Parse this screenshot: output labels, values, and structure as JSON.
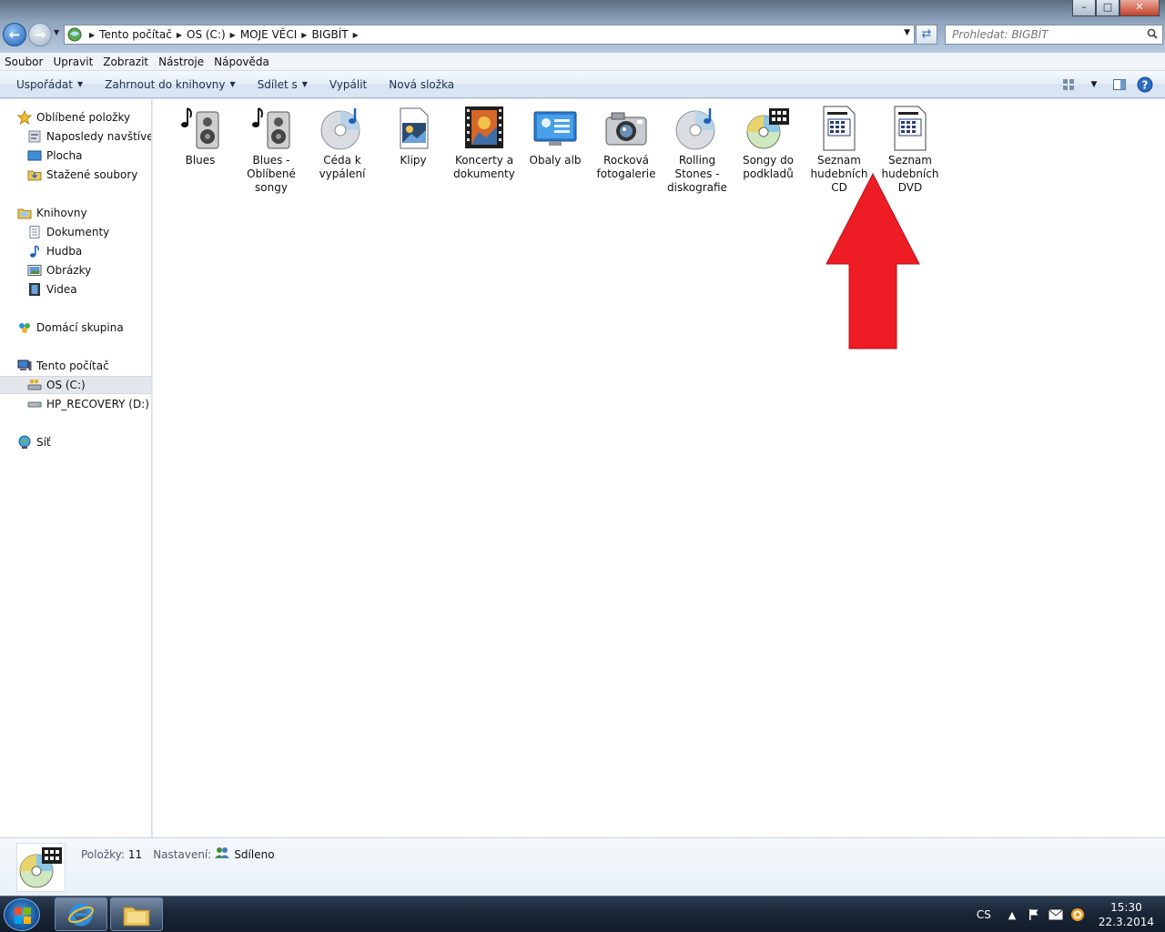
{
  "window": {
    "minimize_glyph": "–",
    "maximize_glyph": "□",
    "close_glyph": "✕"
  },
  "address": {
    "crumbs": [
      "Tento počítač",
      "OS (C:)",
      "MOJE VĚCI",
      "BIGBÍT"
    ],
    "search_placeholder": "Prohledat: BIGBÍT"
  },
  "menu": {
    "items": [
      "Soubor",
      "Upravit",
      "Zobrazit",
      "Nástroje",
      "Nápověda"
    ]
  },
  "commands": {
    "organize": "Uspořádat",
    "include_library": "Zahrnout do knihovny",
    "share_with": "Sdílet s",
    "burn": "Vypálit",
    "new_folder": "Nová složka"
  },
  "nav": {
    "favorites": "Oblíbené položky",
    "recent": "Naposledy navštívené",
    "desktop": "Plocha",
    "downloads": "Stažené soubory",
    "libraries": "Knihovny",
    "documents": "Dokumenty",
    "music": "Hudba",
    "pictures": "Obrázky",
    "videos": "Videa",
    "homegroup": "Domácí skupina",
    "computer": "Tento počítač",
    "drive_c": "OS (C:)",
    "drive_d": "HP_RECOVERY (D:)",
    "network": "Síť"
  },
  "files": [
    {
      "label": "Blues",
      "icon": "music-folder-icon"
    },
    {
      "label": "Blues - Oblíbené songy",
      "icon": "music-folder-icon"
    },
    {
      "label": "Céda k vypálení",
      "icon": "cd-music-icon"
    },
    {
      "label": "Klipy",
      "icon": "video-clip-icon"
    },
    {
      "label": "Koncerty a dokumenty",
      "icon": "film-strip-icon"
    },
    {
      "label": "Obaly alb",
      "icon": "monitor-folder-icon"
    },
    {
      "label": "Rocková fotogalerie",
      "icon": "camera-icon"
    },
    {
      "label": "Rolling Stones - diskografie",
      "icon": "cd-music-icon"
    },
    {
      "label": "Songy do podkladů",
      "icon": "cd-film-icon"
    },
    {
      "label": "Seznam hudebních CD",
      "icon": "document-icon"
    },
    {
      "label": "Seznam hudebních DVD",
      "icon": "document-icon"
    }
  ],
  "details": {
    "items_label": "Položky:",
    "items_count": "11",
    "settings_label": "Nastavení:",
    "shared": "Sdíleno"
  },
  "taskbar": {
    "language": "CS",
    "time": "15:30",
    "date": "22.3.2014"
  },
  "colors": {
    "arrow": "#ee1c25",
    "accent": "#1f5fb8"
  }
}
